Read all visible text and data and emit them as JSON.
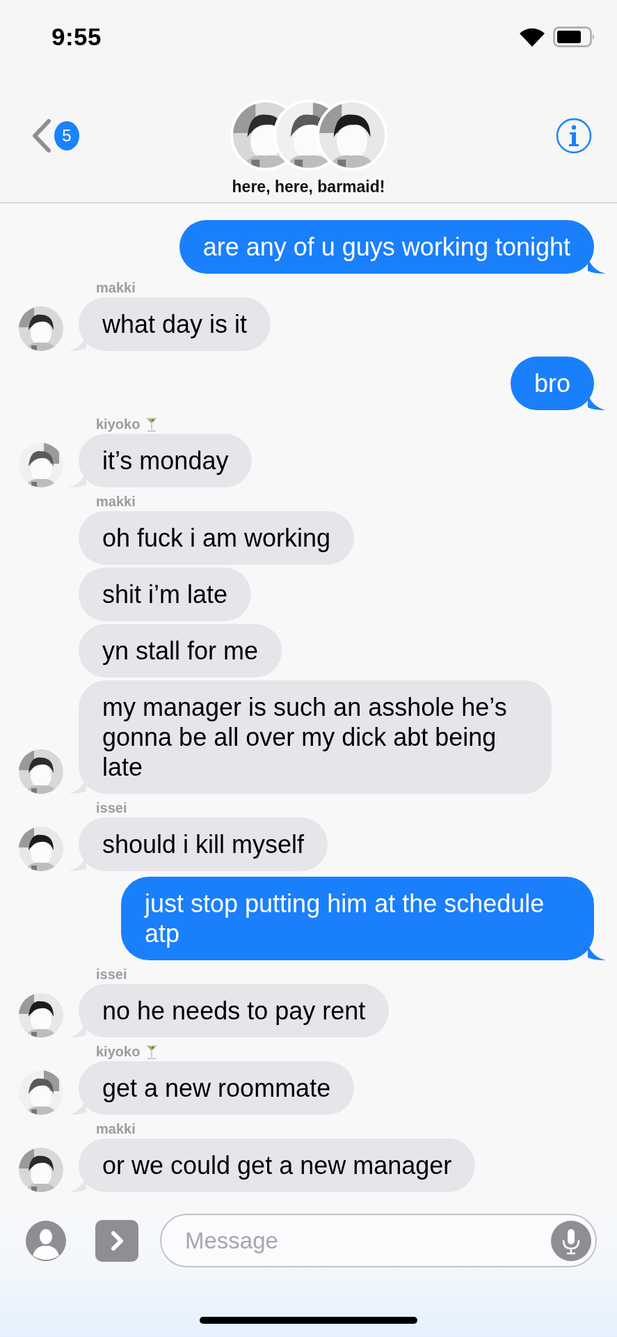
{
  "status_bar": {
    "time": "9:55"
  },
  "header": {
    "back_count": "5",
    "title": "here, here, barmaid!"
  },
  "groups": [
    {
      "kind": "sent",
      "messages": [
        "are any of u guys working tonight"
      ]
    },
    {
      "kind": "received",
      "sender": "makki",
      "cocktail": false,
      "messages": [
        "what day is it"
      ]
    },
    {
      "kind": "sent",
      "messages": [
        "bro"
      ]
    },
    {
      "kind": "received",
      "sender": "kiyoko",
      "cocktail": true,
      "messages": [
        "it’s monday"
      ]
    },
    {
      "kind": "received",
      "sender": "makki",
      "cocktail": false,
      "messages": [
        "oh fuck i am working",
        "shit i’m late",
        "yn stall for me",
        "my manager is such an asshole he’s gonna be all over my dick abt being late"
      ]
    },
    {
      "kind": "received",
      "sender": "issei",
      "cocktail": false,
      "messages": [
        "should i kill myself"
      ]
    },
    {
      "kind": "sent",
      "messages": [
        "just stop putting him at the schedule atp"
      ]
    },
    {
      "kind": "received",
      "sender": "issei",
      "cocktail": false,
      "messages": [
        "no he needs to pay rent"
      ]
    },
    {
      "kind": "received",
      "sender": "kiyoko",
      "cocktail": true,
      "messages": [
        "get a new roommate"
      ]
    },
    {
      "kind": "received",
      "sender": "makki",
      "cocktail": false,
      "messages": [
        "or we could get a new manager"
      ]
    }
  ],
  "composer": {
    "placeholder": "Message"
  }
}
